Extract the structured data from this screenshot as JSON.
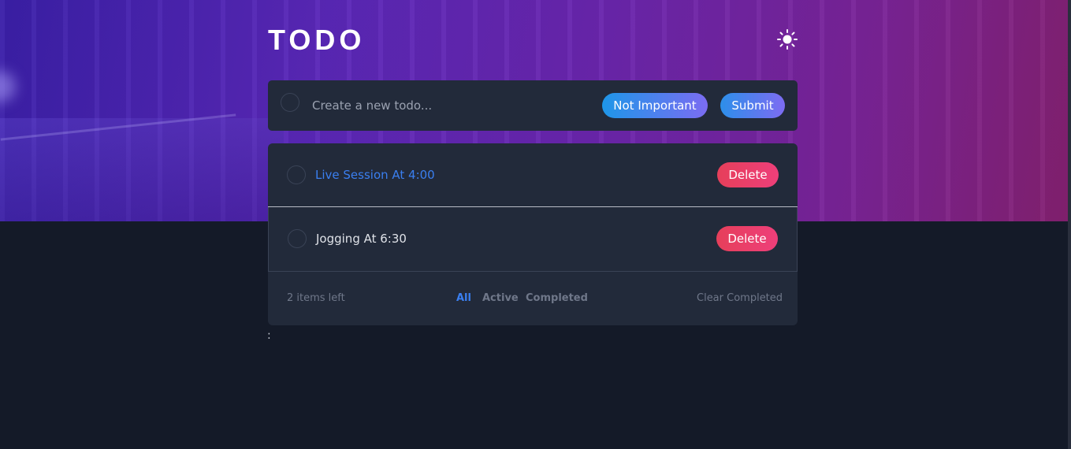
{
  "app": {
    "title": "TODO",
    "theme_icon": "sun-icon"
  },
  "colors": {
    "page_bg": "#141a28",
    "card_bg": "#222a3a",
    "accent_blue": "#3a7ff0",
    "delete_red": "#e63f5a",
    "muted_text": "#6f7789",
    "todo_text": "#dfe2e8"
  },
  "new_todo": {
    "placeholder": "Create a new todo...",
    "value": "",
    "priority_label": "Not Important",
    "submit_label": "Submit"
  },
  "todos": [
    {
      "text": "Live Session At 4:00",
      "important": true,
      "completed": false,
      "delete_label": "Delete"
    },
    {
      "text": "Jogging At 6:30",
      "important": false,
      "completed": false,
      "delete_label": "Delete"
    }
  ],
  "footer": {
    "items_left": "2 items left",
    "filters": [
      "All",
      "Active",
      "Completed"
    ],
    "active_filter": "All",
    "clear_label": "Clear Completed"
  },
  "stray_text": ":"
}
